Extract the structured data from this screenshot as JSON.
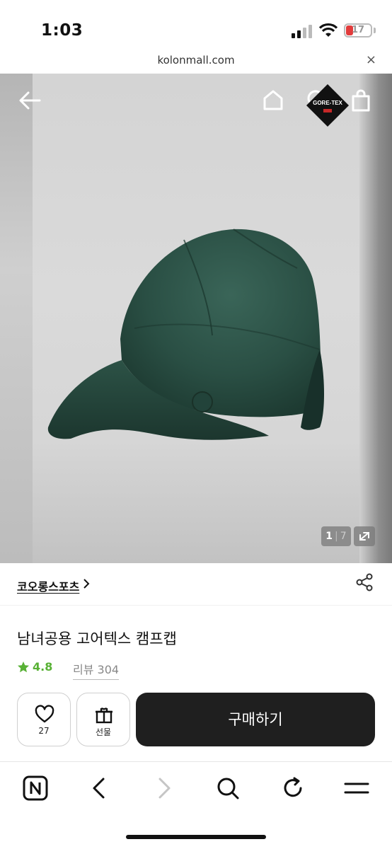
{
  "status_bar": {
    "time": "1:03",
    "battery": "17",
    "battery_color": "#e23b3b"
  },
  "browser": {
    "url": "kolonmall.com",
    "close_glyph": "×"
  },
  "hero": {
    "nav_icons": [
      "back-arrow-icon",
      "home-icon",
      "search-icon",
      "shopping-bag-icon"
    ],
    "badge": "GORE-TEX",
    "image_counter": {
      "current": "1",
      "separator": "|",
      "total": "7"
    }
  },
  "product": {
    "brand": "코오롱스포츠",
    "title": "남녀공용 고어텍스 캠프캡",
    "rating": "4.8",
    "review": "리뷰 304",
    "accent_color": "#58b135"
  },
  "actions": {
    "like_count": "27",
    "gift_label": "선물",
    "buy_label": "구매하기"
  },
  "toolbar": {
    "icons": [
      "naver-n-icon",
      "back-icon",
      "forward-icon",
      "search-icon",
      "refresh-icon",
      "menu-icon"
    ]
  }
}
